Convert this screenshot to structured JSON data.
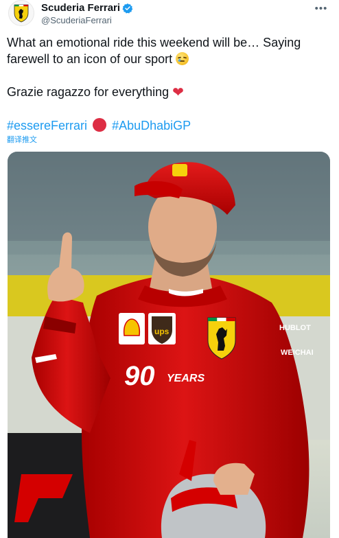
{
  "header": {
    "display_name": "Scuderia Ferrari",
    "handle": "@ScuderiaFerrari",
    "more_label": "•••"
  },
  "tweet": {
    "line1": "What an emotional ride this weekend will be… Saying",
    "line2": "farewell to an icon of our sport",
    "line3": "Grazie ragazzo for everything",
    "hashtag1": "#essereFerrari",
    "hashtag2": "#AbuDhabiGP",
    "heart": "❤"
  },
  "translate_label": "翻译推文",
  "media": {
    "alt": "Driver in red racing suit raising index finger",
    "suit_number": "90",
    "sponsor_ups": "ups",
    "sponsor_years": "YEARS",
    "sponsor_hublot": "HUBLOT",
    "sponsor_weichai": "WEICHAI"
  },
  "colors": {
    "ferrari_red": "#d40000",
    "link_blue": "#1d9bf0",
    "verified_blue": "#1d9bf0",
    "text": "#0f1419",
    "muted": "#536471"
  }
}
